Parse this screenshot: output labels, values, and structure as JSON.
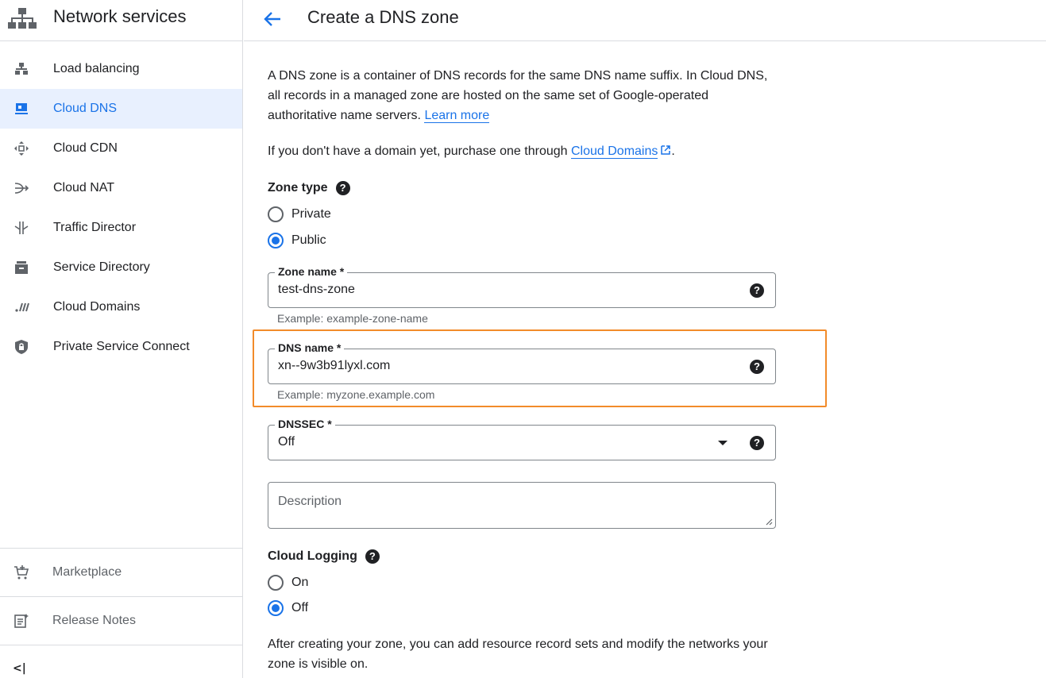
{
  "sidebar": {
    "title": "Network services",
    "items": [
      {
        "label": "Load balancing",
        "icon": "load-balancing-icon"
      },
      {
        "label": "Cloud DNS",
        "icon": "cloud-dns-icon",
        "active": true
      },
      {
        "label": "Cloud CDN",
        "icon": "cloud-cdn-icon"
      },
      {
        "label": "Cloud NAT",
        "icon": "cloud-nat-icon"
      },
      {
        "label": "Traffic Director",
        "icon": "traffic-director-icon"
      },
      {
        "label": "Service Directory",
        "icon": "service-directory-icon"
      },
      {
        "label": "Cloud Domains",
        "icon": "cloud-domains-icon"
      },
      {
        "label": "Private Service Connect",
        "icon": "private-service-connect-icon"
      }
    ],
    "bottom": [
      {
        "label": "Marketplace",
        "icon": "cart-icon"
      },
      {
        "label": "Release Notes",
        "icon": "release-notes-icon"
      }
    ],
    "collapse_glyph": "<|"
  },
  "header": {
    "title": "Create a DNS zone"
  },
  "intro": {
    "line1": "A DNS zone is a container of DNS records for the same DNS name suffix. In Cloud DNS,",
    "line2": "all records in a managed zone are hosted on the same set of Google-operated",
    "line3": "authoritative name servers.",
    "learn_more": "Learn more",
    "domain_prefix": "If you don't have a domain yet, purchase one through",
    "domain_link": "Cloud Domains",
    "domain_suffix": "."
  },
  "zone_type": {
    "label": "Zone type",
    "options": [
      {
        "label": "Private",
        "checked": false
      },
      {
        "label": "Public",
        "checked": true
      }
    ]
  },
  "zone_name": {
    "label": "Zone name *",
    "value": "test-dns-zone",
    "hint": "Example: example-zone-name"
  },
  "dns_name": {
    "label": "DNS name *",
    "value": "xn--9w3b91lyxl.com",
    "hint": "Example: myzone.example.com"
  },
  "dnssec": {
    "label": "DNSSEC *",
    "value": "Off"
  },
  "description": {
    "placeholder": "Description"
  },
  "cloud_logging": {
    "label": "Cloud Logging",
    "options": [
      {
        "label": "On",
        "checked": false
      },
      {
        "label": "Off",
        "checked": true
      }
    ]
  },
  "footer_text": {
    "line1": "After creating your zone, you can add resource record sets and modify the networks your",
    "line2": "zone is visible on."
  },
  "help_glyph": "?",
  "colors": {
    "accent": "#1a73e8",
    "highlight": "#f28b2a",
    "active_bg": "#e8f0fe"
  }
}
